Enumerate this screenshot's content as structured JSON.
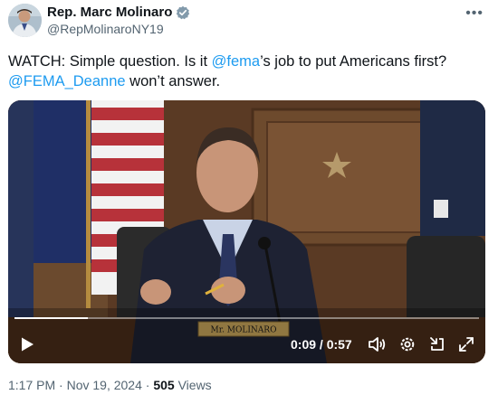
{
  "author": {
    "display_name": "Rep. Marc Molinaro",
    "handle": "@RepMolinaroNY19",
    "verified": true
  },
  "menu_icon": "more-dots-icon",
  "text": {
    "part1": "WATCH: Simple question. Is it ",
    "mention1": "@fema",
    "part2": "’s job to put Americans first?",
    "mention2": "@FEMA_Deanne",
    "part3": " won’t answer."
  },
  "video": {
    "nameplate": "Mr. MOLINARO",
    "time_display": "0:09 / 0:57",
    "progress": 0.158,
    "controls": [
      "play-icon",
      "volume-icon",
      "settings-gear-icon",
      "minimize-icon",
      "fullscreen-icon"
    ]
  },
  "meta": {
    "time": "1:17 PM",
    "date": "Nov 19, 2024",
    "views_count": "505",
    "views_label": "Views",
    "sep": " · "
  },
  "colors": {
    "link": "#1d9bf0",
    "secondary": "#536471",
    "verified": "#829aab"
  }
}
